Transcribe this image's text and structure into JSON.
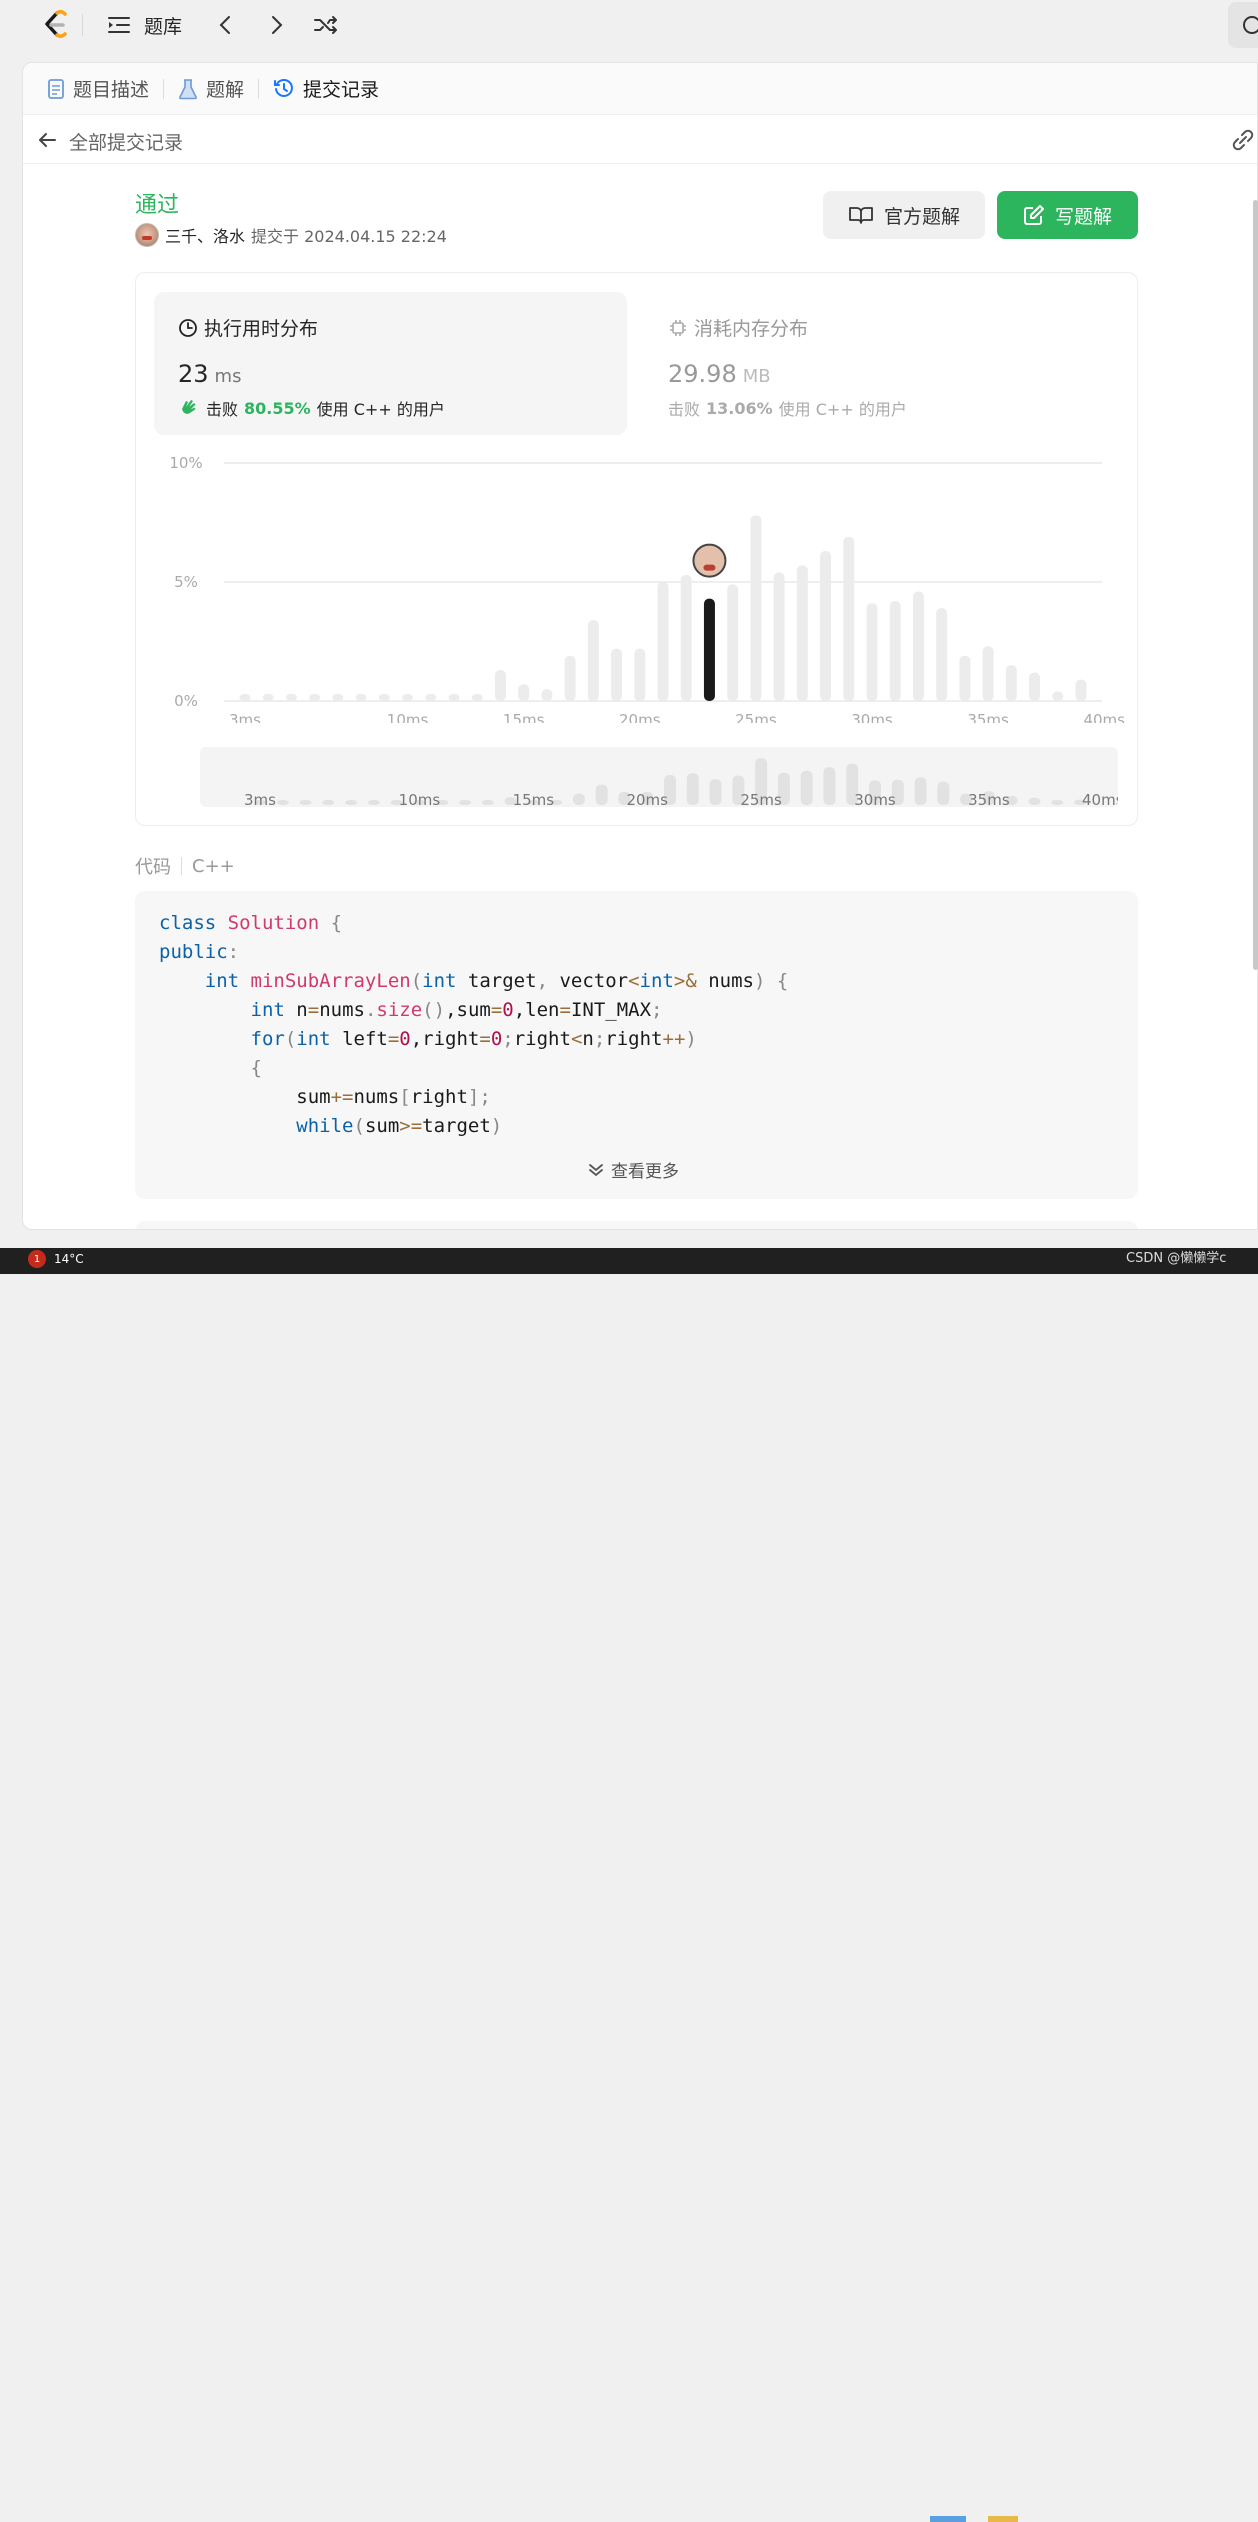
{
  "topbar": {
    "problem_bank_label": "题库",
    "accent": "#ffa116"
  },
  "tabs": [
    {
      "label": "题目描述",
      "icon": "document-icon"
    },
    {
      "label": "题解",
      "icon": "flask-icon"
    },
    {
      "label": "提交记录",
      "icon": "history-icon",
      "active": true
    }
  ],
  "subheader": {
    "title": "全部提交记录"
  },
  "submission": {
    "status": "通过",
    "status_color": "#2db55d",
    "author": "三千、洛水",
    "submitted_at": "提交于 2024.04.15 22:24"
  },
  "actions": {
    "official_solution": "官方题解",
    "write_solution": "写题解"
  },
  "runtime": {
    "title": "执行用时分布",
    "value": "23",
    "unit": "ms",
    "beat_prefix": "击败",
    "beat_pct": "80.55%",
    "beat_suffix": "使用 C++ 的用户"
  },
  "memory": {
    "title": "消耗内存分布",
    "value": "29.98",
    "unit": "MB",
    "beat_prefix": "击败",
    "beat_pct": "13.06%",
    "beat_suffix": "使用 C++ 的用户"
  },
  "chart_data": {
    "type": "bar",
    "x_unit": "ms",
    "x": [
      3,
      4,
      5,
      6,
      7,
      8,
      9,
      10,
      11,
      12,
      13,
      14,
      15,
      16,
      17,
      18,
      19,
      20,
      21,
      22,
      23,
      24,
      25,
      26,
      27,
      28,
      29,
      30,
      31,
      32,
      33,
      34,
      35,
      36,
      37,
      38,
      39,
      40
    ],
    "values": [
      0.3,
      0.3,
      0.3,
      0.3,
      0.3,
      0.3,
      0.3,
      0.3,
      0.3,
      0.3,
      0.3,
      1.3,
      0.7,
      0.5,
      1.9,
      3.4,
      2.2,
      2.2,
      5.0,
      5.3,
      4.3,
      4.9,
      7.8,
      5.4,
      5.7,
      6.3,
      6.9,
      4.1,
      4.2,
      4.6,
      3.9,
      1.9,
      2.3,
      1.5,
      1.2,
      0.4,
      0.9
    ],
    "highlight_x": 23,
    "y_ticks": [
      "10%",
      "5%",
      "0%"
    ],
    "ylim": [
      0,
      10
    ],
    "x_tick_labels": [
      "3ms",
      "10ms",
      "15ms",
      "20ms",
      "25ms",
      "30ms",
      "35ms",
      "40ms"
    ],
    "x_tick_values": [
      3,
      10,
      15,
      20,
      25,
      30,
      35,
      40
    ],
    "minimap_tick_labels": [
      "3ms",
      "10ms",
      "15ms",
      "20ms",
      "25ms",
      "30ms",
      "35ms",
      "40ms"
    ]
  },
  "code": {
    "label": "代码",
    "language": "C++",
    "show_more": "查看更多"
  },
  "taskbar": {
    "badge_count": "1",
    "temperature": "14°C"
  },
  "watermark": "CSDN @懒懒学c"
}
